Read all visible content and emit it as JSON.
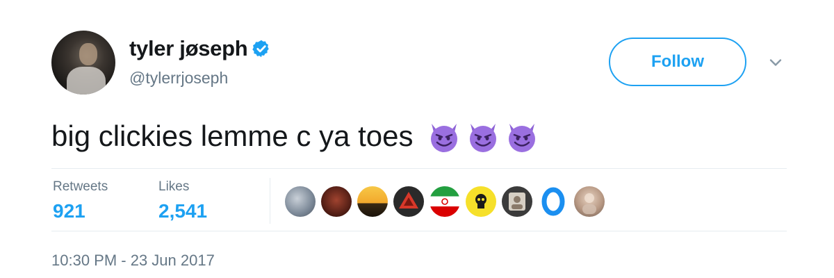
{
  "user": {
    "display_name": "tyler jøseph",
    "handle": "@tylerrjoseph",
    "verified": true
  },
  "actions": {
    "follow_label": "Follow"
  },
  "tweet": {
    "text": "big clickies lemme c ya toes",
    "emojis": [
      "smiling-devil-emoji",
      "smiling-devil-emoji",
      "smiling-devil-emoji"
    ]
  },
  "stats": {
    "retweets_label": "Retweets",
    "retweets_value": "921",
    "likes_label": "Likes",
    "likes_value": "2,541"
  },
  "likers": [
    {
      "icon": "avatar-bluegray"
    },
    {
      "icon": "avatar-darkred"
    },
    {
      "icon": "avatar-sunset"
    },
    {
      "icon": "avatar-red-triangle"
    },
    {
      "icon": "avatar-iran-flag"
    },
    {
      "icon": "avatar-yellow-skull"
    },
    {
      "icon": "avatar-dark-frame"
    },
    {
      "icon": "avatar-blue-ring"
    },
    {
      "icon": "avatar-person"
    }
  ],
  "timestamp": "10:30 PM - 23 Jun 2017",
  "colors": {
    "accent": "#1da1f2",
    "secondary_text": "#657786",
    "divider": "#e6ecf0",
    "emoji_purple": "#8e63d6"
  }
}
